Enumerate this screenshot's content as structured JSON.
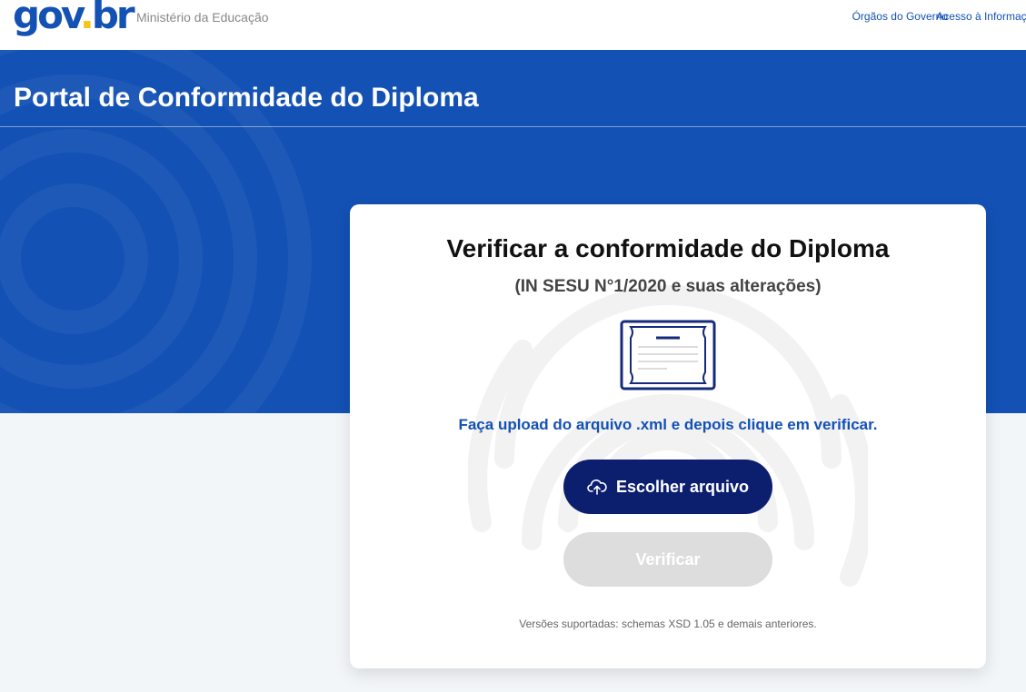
{
  "header": {
    "logo": {
      "part1": "gov",
      "dot": ".",
      "part2": "br"
    },
    "ministry": "Ministério da Educação",
    "links": [
      "Órgãos do Governo",
      "Acesso à Informação"
    ]
  },
  "hero": {
    "title": "Portal de Conformidade do Diploma"
  },
  "card": {
    "title": "Verificar a conformidade do Diploma",
    "subtitle": "(IN SESU N°1/2020 e suas alterações)",
    "diploma_icon": "diploma-certificate-icon",
    "instructions": "Faça upload do arquivo .xml e depois clique em verificar.",
    "choose_button": {
      "label": "Escolher arquivo",
      "icon": "cloud-upload-icon"
    },
    "verify_button": {
      "label": "Verificar",
      "enabled": false
    },
    "versions_note": "Versões suportadas: schemas XSD 1.05 e demais anteriores."
  },
  "colors": {
    "primary_blue": "#1351b4",
    "dark_navy": "#0c1f6e",
    "logo_green": "#25a94a",
    "logo_yellow": "#f5c518",
    "disabled_gray": "#dddddd",
    "page_bg": "#f3f6f8"
  }
}
